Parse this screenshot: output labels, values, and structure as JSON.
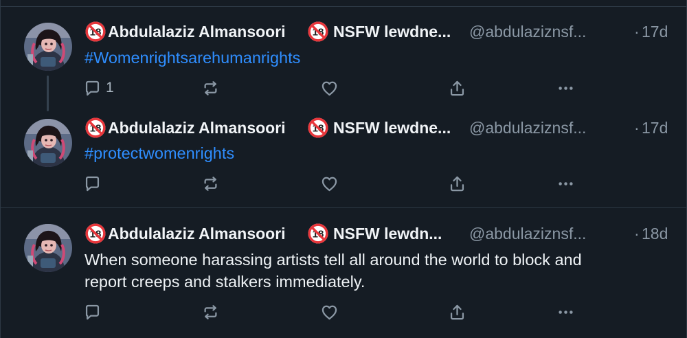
{
  "colors": {
    "background": "#151c24",
    "divider": "#2d3945",
    "name_text": "#f1f4f7",
    "muted_text": "#8b98a5",
    "body_text": "#eef2f5",
    "hashtag": "#2f8eff",
    "icon": "#8b98a5"
  },
  "posts": [
    {
      "author_name": "Abdulalaziz Almansoori",
      "display_extra": "NSFW lewdne...",
      "handle": "@abdulaziznsf...",
      "separator": "·",
      "time": "17d",
      "text": "#Womenrightsarehumanrights",
      "text_is_hashtag": true,
      "actions": {
        "reply_icon": "reply-icon",
        "reply_count": "1",
        "repost_icon": "repost-icon",
        "like_icon": "like-icon",
        "share_icon": "share-icon",
        "more_icon": "more-icon"
      }
    },
    {
      "author_name": "Abdulalaziz Almansoori",
      "display_extra": "NSFW lewdne...",
      "handle": "@abdulaziznsf...",
      "separator": "·",
      "time": "17d",
      "text": "#protectwomenrights",
      "text_is_hashtag": true,
      "actions": {
        "reply_icon": "reply-icon",
        "reply_count": "",
        "repost_icon": "repost-icon",
        "like_icon": "like-icon",
        "share_icon": "share-icon",
        "more_icon": "more-icon"
      }
    },
    {
      "author_name": "Abdulalaziz Almansoori",
      "display_extra": "NSFW lewdn...",
      "handle": "@abdulaziznsf...",
      "separator": "·",
      "time": "18d",
      "text_line1": "When someone harassing artists tell all around the world to block and",
      "text_line2": "report creeps and stalkers immediately.",
      "text_is_hashtag": false,
      "actions": {
        "reply_icon": "reply-icon",
        "reply_count": "",
        "repost_icon": "repost-icon",
        "like_icon": "like-icon",
        "share_icon": "share-icon",
        "more_icon": "more-icon"
      }
    }
  ]
}
